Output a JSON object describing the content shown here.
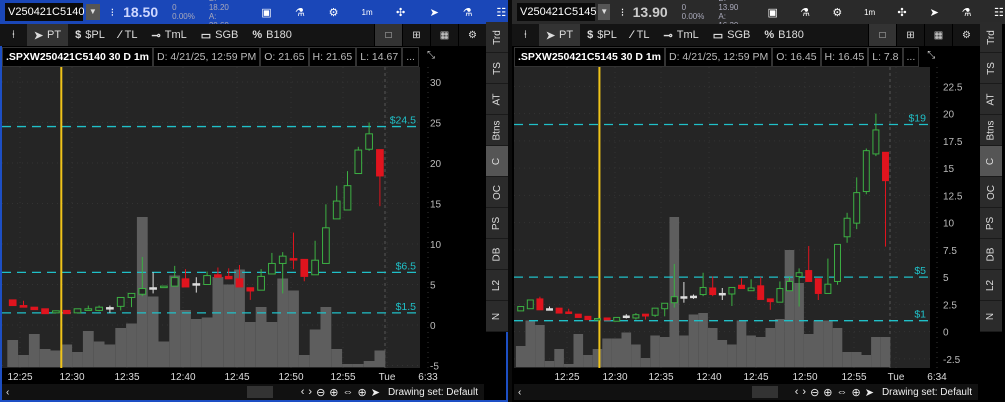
{
  "colors": {
    "up": "#3cb043",
    "down": "#e0141e",
    "doji": "#dddddd",
    "level": "#20c0c8",
    "cursor": "#f0c419",
    "volume": "#5e5e5e",
    "accent": "#1a47b8"
  },
  "toolbar": {
    "icons": [
      "pin-icon",
      "pointer-icon",
      "dollar-pl-icon",
      "trendline-icon",
      "timeline-icon",
      "box-icon",
      "percent-icon"
    ],
    "pt": "PT",
    "pl": "$PL",
    "tl": "TL",
    "tml": "TmL",
    "sgb": "SGB",
    "b180": "B180",
    "top_icons": [
      "screenshot-icon",
      "flask-icon",
      "gear-icon",
      "timeframe-1m",
      "drawing-icon",
      "cursor-icon",
      "study-icon",
      "chart-style-icon"
    ],
    "timeframe": "1m"
  },
  "sidebar": [
    "Trd",
    "TS",
    "AT",
    "Btns",
    "C",
    "OC",
    "PS",
    "DB",
    "L2",
    "N"
  ],
  "sidebar_selected": "C",
  "bottom": {
    "drawing_set": "Drawing set: Default"
  },
  "panels": [
    {
      "symbol": "V250421C5140",
      "last": "18.50",
      "change": "0",
      "change_pct": "0.00%",
      "bid": "B: 18.20",
      "ask": "A: 20.60",
      "info": {
        "title": ".SPXW250421C5140 30 D 1m",
        "date": "D: 4/21/25, 12:59 PM",
        "open": "O: 21.65",
        "high": "H: 21.65",
        "low": "L: 14.67",
        "more": "..."
      },
      "y_ticks": [
        "30",
        "25",
        "20",
        "15",
        "10",
        "5",
        "0",
        "-5"
      ],
      "y_tick_values": [
        30,
        25,
        20,
        15,
        10,
        5,
        0,
        -5
      ],
      "x_ticks": [
        "12:25",
        "12:30",
        "12:35",
        "12:40",
        "12:45",
        "12:50",
        "12:55",
        "Tue",
        "6:33"
      ],
      "levels": [
        {
          "label": "$24.5",
          "value": 24.5
        },
        {
          "label": "$6.5",
          "value": 6.5
        },
        {
          "label": "$1.5",
          "value": 1.5
        }
      ],
      "cursor_index": 4.5,
      "candles": [
        [
          3.1,
          3.1,
          2.4,
          2.4
        ],
        [
          2.4,
          3.0,
          2.2,
          2.2
        ],
        [
          2.2,
          2.2,
          1.9,
          1.9
        ],
        [
          2.0,
          2.0,
          1.4,
          1.4
        ],
        [
          1.5,
          1.8,
          1.5,
          1.75
        ],
        [
          1.8,
          1.8,
          1.4,
          1.4
        ],
        [
          1.5,
          2.0,
          1.5,
          2.0
        ],
        [
          1.8,
          2.4,
          1.8,
          2.0
        ],
        [
          1.8,
          2.4,
          1.7,
          2.2
        ],
        [
          2.15,
          2.4,
          1.5,
          2.15
        ],
        [
          2.3,
          3.4,
          1.8,
          3.4
        ],
        [
          3.4,
          3.9,
          2.2,
          3.9
        ],
        [
          3.8,
          8.4,
          3.55,
          4.5
        ],
        [
          4.6,
          6.5,
          3.9,
          4.6
        ],
        [
          4.7,
          4.8,
          4.7,
          4.8
        ],
        [
          4.8,
          7.3,
          4.8,
          5.85
        ],
        [
          5.7,
          6.9,
          4.7,
          4.7
        ],
        [
          5.1,
          5.9,
          4.0,
          5.1
        ],
        [
          5.0,
          6.6,
          5.0,
          6.1
        ],
        [
          6.2,
          7.1,
          5.9,
          5.9
        ],
        [
          6.0,
          7.0,
          5.7,
          5.7
        ],
        [
          5.7,
          7.4,
          4.7,
          4.7
        ],
        [
          4.6,
          4.6,
          3.1,
          4.2
        ],
        [
          4.3,
          6.9,
          4.3,
          6.0
        ],
        [
          6.3,
          8.9,
          6.3,
          7.6
        ],
        [
          7.6,
          9.0,
          3.9,
          8.5
        ],
        [
          8.2,
          11.4,
          6.9,
          8.1
        ],
        [
          8.1,
          8.1,
          5.4,
          6.0
        ],
        [
          6.2,
          10.4,
          6.2,
          8.0
        ],
        [
          7.6,
          14.9,
          7.6,
          12.0
        ],
        [
          13.1,
          17.2,
          13.1,
          15.3
        ],
        [
          14.2,
          19.0,
          14.2,
          17.2
        ],
        [
          18.7,
          22.0,
          18.7,
          21.6
        ],
        [
          21.7,
          25.0,
          21.5,
          23.6
        ],
        [
          21.65,
          21.65,
          14.67,
          18.4
        ]
      ],
      "volume": [
        18,
        8,
        22,
        12,
        11,
        15,
        10,
        24,
        17,
        15,
        26,
        29,
        100,
        47,
        17,
        61,
        38,
        32,
        33,
        60,
        55,
        65,
        30,
        40,
        30,
        59,
        51,
        8,
        25,
        40,
        12,
        2,
        2,
        4,
        11
      ]
    },
    {
      "symbol": "V250421C5145",
      "last": "13.90",
      "change": "0",
      "change_pct": "0.00%",
      "bid": "B: 13.90",
      "ask": "A: 16.30",
      "info": {
        "title": ".SPXW250421C5145 30 D 1m",
        "date": "D: 4/21/25, 12:59 PM",
        "open": "O: 16.45",
        "high": "H: 16.45",
        "low": "L: 7.8",
        "more": "..."
      },
      "y_ticks": [
        "22.5",
        "20",
        "17.5",
        "15",
        "12.5",
        "10",
        "7.5",
        "5",
        "2.5",
        "0",
        "-2.5"
      ],
      "y_tick_values": [
        22.5,
        20,
        17.5,
        15,
        12.5,
        10,
        7.5,
        5,
        2.5,
        0,
        -2.5
      ],
      "x_ticks": [
        "12:25",
        "12:30",
        "12:35",
        "12:40",
        "12:45",
        "12:50",
        "12:55",
        "Tue",
        "6:34"
      ],
      "levels": [
        {
          "label": "$19",
          "value": 19
        },
        {
          "label": "$5",
          "value": 5
        },
        {
          "label": "$1",
          "value": 1
        }
      ],
      "cursor_index": 8.2,
      "candles": [
        [
          1.9,
          2.3,
          1.9,
          2.3
        ],
        [
          2.1,
          2.9,
          2.1,
          2.9
        ],
        [
          3.0,
          3.2,
          2.0,
          2.0
        ],
        [
          2.1,
          2.3,
          2.1,
          2.1
        ],
        [
          2.15,
          2.15,
          1.7,
          1.7
        ],
        [
          1.8,
          2.1,
          1.7,
          1.7
        ],
        [
          1.6,
          1.6,
          1.3,
          1.3
        ],
        [
          1.4,
          1.4,
          1.1,
          1.1
        ],
        [
          1.06,
          1.2,
          1.06,
          1.2
        ],
        [
          1.25,
          1.25,
          1.06,
          1.06
        ],
        [
          0.95,
          1.3,
          0.95,
          1.3
        ],
        [
          1.43,
          1.6,
          1.2,
          1.43
        ],
        [
          1.25,
          1.7,
          1.1,
          1.55
        ],
        [
          1.6,
          1.6,
          1.1,
          1.43
        ],
        [
          1.5,
          2.15,
          1.35,
          2.15
        ],
        [
          2.1,
          2.6,
          1.4,
          2.6
        ],
        [
          2.65,
          6.2,
          2.2,
          3.2
        ],
        [
          3.2,
          4.55,
          2.65,
          3.2
        ],
        [
          3.25,
          3.4,
          3.0,
          3.25
        ],
        [
          3.4,
          5.4,
          3.25,
          4.05
        ],
        [
          4.0,
          5.05,
          3.25,
          3.4
        ],
        [
          3.5,
          4.0,
          2.9,
          3.5
        ],
        [
          3.45,
          4.05,
          2.35,
          4.05
        ],
        [
          4.25,
          4.9,
          3.95,
          3.95
        ],
        [
          3.75,
          4.8,
          3.75,
          4.0
        ],
        [
          4.2,
          5.0,
          2.95,
          2.95
        ],
        [
          3.0,
          3.0,
          2.0,
          2.75
        ],
        [
          2.7,
          4.6,
          2.7,
          3.95
        ],
        [
          3.75,
          5.0,
          3.75,
          4.6
        ],
        [
          5.05,
          5.8,
          2.3,
          5.4
        ],
        [
          5.6,
          7.85,
          4.6,
          4.6
        ],
        [
          4.85,
          4.85,
          2.9,
          3.5
        ],
        [
          3.5,
          6.7,
          3.5,
          4.35
        ],
        [
          4.6,
          8.0,
          4.3,
          8.0
        ],
        [
          8.7,
          10.9,
          8.15,
          10.4
        ],
        [
          9.95,
          14.15,
          9.4,
          12.75
        ],
        [
          12.85,
          16.8,
          12.6,
          16.6
        ],
        [
          16.3,
          20.0,
          16.1,
          18.5
        ],
        [
          16.45,
          16.45,
          7.8,
          13.85
        ]
      ],
      "volume": [
        14,
        31,
        28,
        4,
        12,
        2,
        22,
        8,
        12,
        19,
        19,
        23,
        15,
        6,
        21,
        20,
        100,
        21,
        35,
        36,
        26,
        18,
        15,
        31,
        21,
        20,
        26,
        32,
        78,
        56,
        22,
        31,
        31,
        26,
        10,
        10,
        8,
        20,
        20
      ]
    }
  ]
}
